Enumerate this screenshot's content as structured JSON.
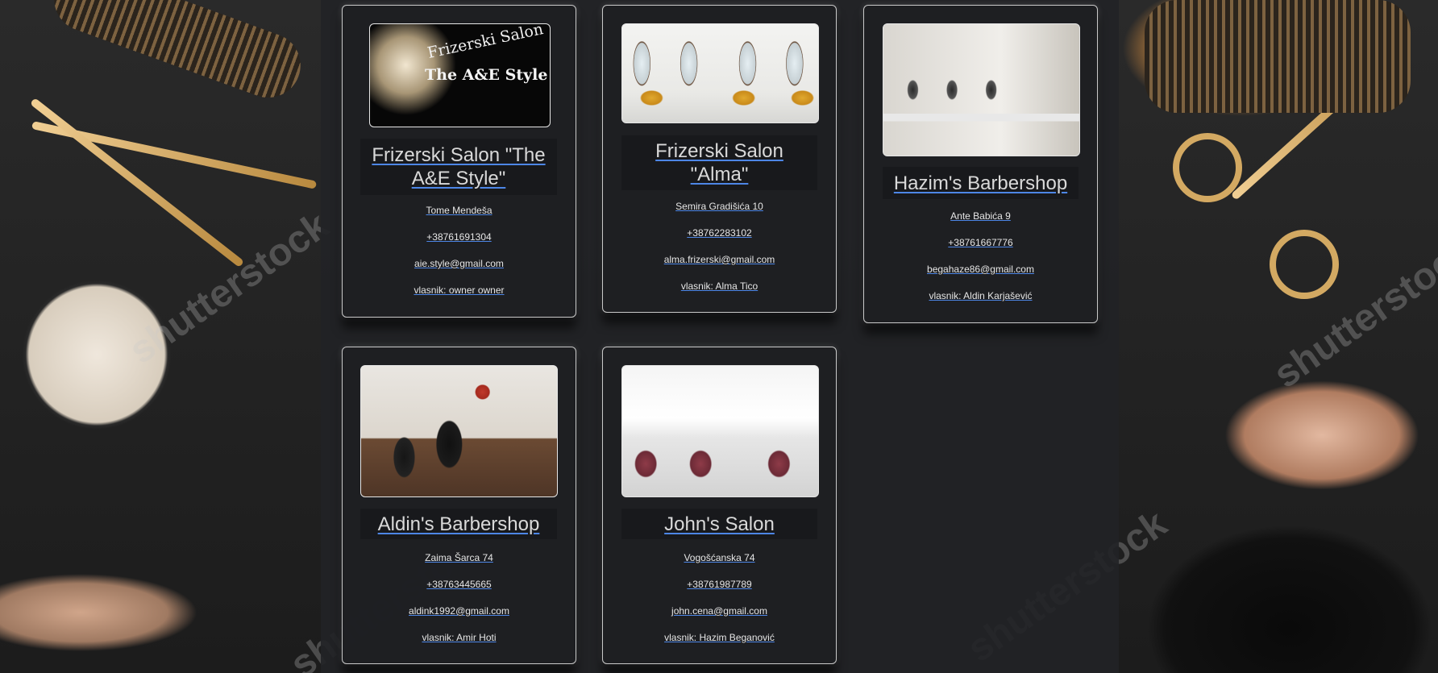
{
  "salons": [
    {
      "name": "Frizerski Salon \"The A&E Style\"",
      "address": "Tome Mendeša",
      "phone": "+38761691304",
      "email": "aie.style@gmail.com",
      "owner": "vlasnik: owner owner",
      "logo_line1": "Frizerski Salon",
      "logo_line2": "The A&E Style"
    },
    {
      "name": "Frizerski Salon \"Alma\"",
      "address": "Semira Gradišića 10",
      "phone": "+38762283102",
      "email": "alma.frizerski@gmail.com",
      "owner": "vlasnik: Alma Tico"
    },
    {
      "name": "Hazim's Barbershop",
      "address": "Ante Babića 9",
      "phone": "+38761667776",
      "email": "begahaze86@gmail.com",
      "owner": "vlasnik: Aldin Karjašević"
    },
    {
      "name": "Aldin's Barbershop",
      "address": "Zaima Šarca 74",
      "phone": "+38763445665",
      "email": "aldink1992@gmail.com",
      "owner": "vlasnik: Amir Hoti"
    },
    {
      "name": "John's Salon",
      "address": "Vogošćanska 74",
      "phone": "+38761987789",
      "email": "john.cena@gmail.com",
      "owner": "vlasnik: Hazim Beganović"
    }
  ],
  "background": {
    "watermark": "shutterstock"
  },
  "colors": {
    "link_underline": "#4d86e6",
    "card_border": "#c9c9c9",
    "text": "#e6e6e6"
  }
}
